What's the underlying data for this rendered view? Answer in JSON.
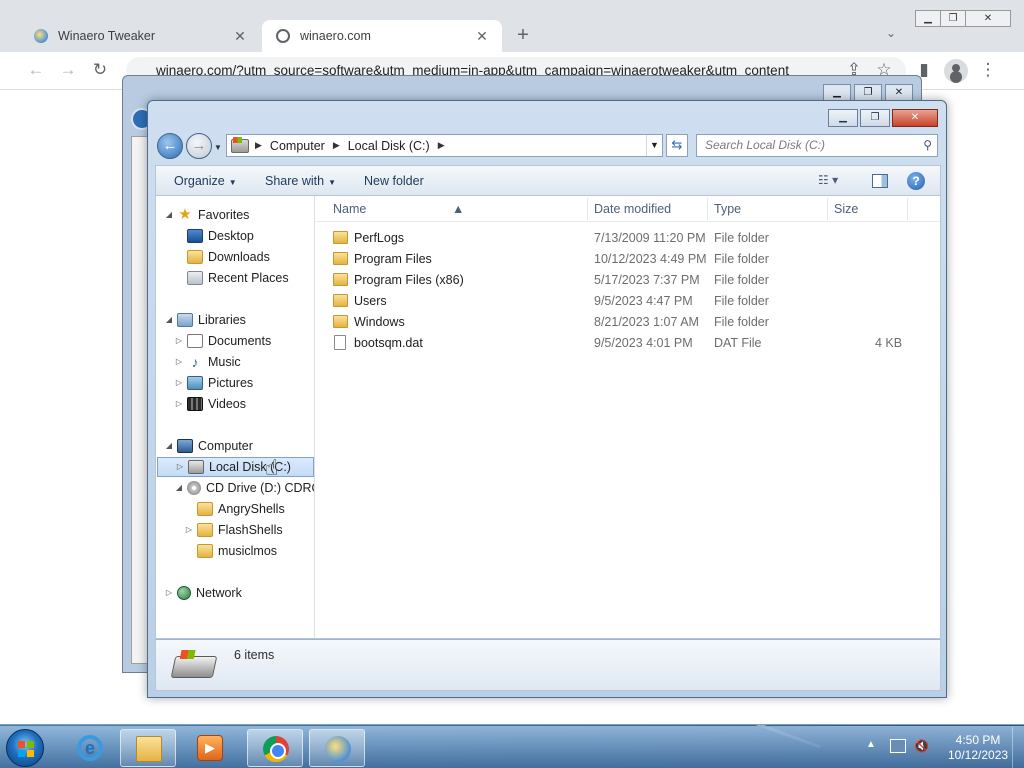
{
  "chrome": {
    "tabs": [
      {
        "title": "Winaero Tweaker"
      },
      {
        "title": "winaero.com"
      }
    ],
    "address": "winaero.com/?utm_source=software&utm_medium=in-app&utm_campaign=winaerotweaker&utm_content"
  },
  "explorer": {
    "breadcrumb": [
      "Computer",
      "Local Disk (C:)"
    ],
    "search_placeholder": "Search Local Disk (C:)",
    "toolbar": {
      "organize": "Organize",
      "share_with": "Share with",
      "new_folder": "New folder"
    },
    "columns": {
      "name": "Name",
      "date_modified": "Date modified",
      "type": "Type",
      "size": "Size"
    },
    "nav": {
      "favorites": "Favorites",
      "desktop": "Desktop",
      "downloads": "Downloads",
      "recent_places": "Recent Places",
      "libraries": "Libraries",
      "documents": "Documents",
      "music": "Music",
      "pictures": "Pictures",
      "videos": "Videos",
      "computer": "Computer",
      "local_disk": "Local Disk (C:)",
      "cd_drive": "CD Drive (D:) CDROM",
      "angry_shells": "AngryShells",
      "flash_shells": "FlashShells",
      "musiclmos": "musiclmos",
      "network": "Network"
    },
    "files": [
      {
        "name": "PerfLogs",
        "date": "7/13/2009 11:20 PM",
        "type": "File folder",
        "size": ""
      },
      {
        "name": "Program Files",
        "date": "10/12/2023 4:49 PM",
        "type": "File folder",
        "size": ""
      },
      {
        "name": "Program Files (x86)",
        "date": "5/17/2023 7:37 PM",
        "type": "File folder",
        "size": ""
      },
      {
        "name": "Users",
        "date": "9/5/2023 4:47 PM",
        "type": "File folder",
        "size": ""
      },
      {
        "name": "Windows",
        "date": "8/21/2023 1:07 AM",
        "type": "File folder",
        "size": ""
      },
      {
        "name": "bootsqm.dat",
        "date": "9/5/2023 4:01 PM",
        "type": "DAT File",
        "size": "4 KB"
      }
    ],
    "status_count": "6 items"
  },
  "taskbar": {
    "time": "4:50 PM",
    "date": "10/12/2023"
  }
}
